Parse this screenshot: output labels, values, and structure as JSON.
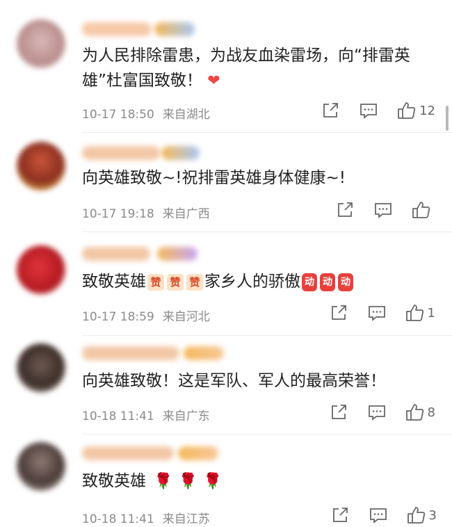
{
  "comments": [
    {
      "text": "为人民排除雷患，为战友血染雷场，向“排雷英雄”杜富国致敬！",
      "emoji_icon": "heart-icon",
      "time": "10-17 18:50",
      "location": "来自湖北",
      "likes": "12"
    },
    {
      "text": "向英雄致敬~!祝排雷英雄身体健康~!",
      "time": "10-17 19:18",
      "location": "来自广西",
      "likes": ""
    },
    {
      "text_a": "致敬英雄",
      "zan": [
        "赞",
        "赞",
        "赞"
      ],
      "text_b": "家乡人的骄傲",
      "stickers": [
        "动",
        "动",
        "动"
      ],
      "time": "10-17 18:59",
      "location": "来自河北",
      "likes": "1"
    },
    {
      "text": "向英雄致敬！这是军队、军人的最高荣誉！",
      "time": "10-18 11:41",
      "location": "来自广东",
      "likes": "8"
    },
    {
      "text": "致敬英雄",
      "emoji_icon": "rose-icon",
      "time": "10-18 11:41",
      "location": "来自江苏",
      "likes": "3"
    }
  ],
  "colors": {
    "accent_heart": "#f04646",
    "meta_gray": "#8a8a8a",
    "icon_gray": "#666666"
  }
}
